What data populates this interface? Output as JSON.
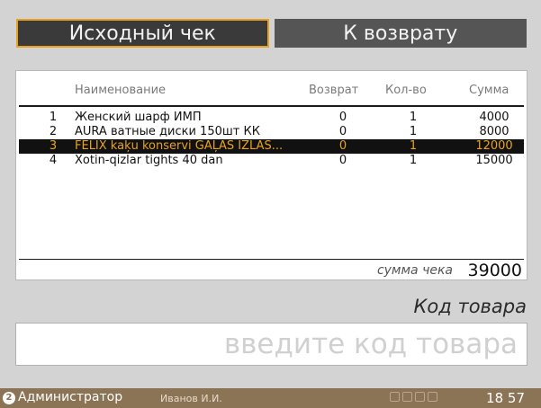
{
  "tabs": [
    {
      "label": "Исходный чек",
      "active": true
    },
    {
      "label": "К возврату",
      "active": false
    }
  ],
  "table": {
    "columns": [
      "Наименование",
      "Возврат",
      "Кол-во",
      "Сумма"
    ],
    "rows": [
      {
        "num": "1",
        "name": "Женский шарф ИМП",
        "ret": "0",
        "qty": "1",
        "sum": "4000"
      },
      {
        "num": "2",
        "name": "AURA ватные диски 150шт КК",
        "ret": "0",
        "qty": "1",
        "sum": "8000"
      },
      {
        "num": "3",
        "name": "FELIX kaķu konservi GAĻAS IZLAS...",
        "ret": "0",
        "qty": "1",
        "sum": "12000"
      },
      {
        "num": "4",
        "name": "Xotin-qizlar tights 40 dan",
        "ret": "0",
        "qty": "1",
        "sum": "15000"
      }
    ],
    "selected_row": 3
  },
  "total": {
    "label": "сумма чека",
    "value": "39000"
  },
  "code": {
    "title": "Код товара",
    "placeholder": "введите код товара"
  },
  "status": {
    "badge": "2",
    "role": "Администратор",
    "user": "Иванов И.И.",
    "time": "18 57"
  },
  "colors": {
    "accent": "#e9a21f",
    "status_bar": "#8b7355",
    "selected_row_bg": "#111111"
  }
}
